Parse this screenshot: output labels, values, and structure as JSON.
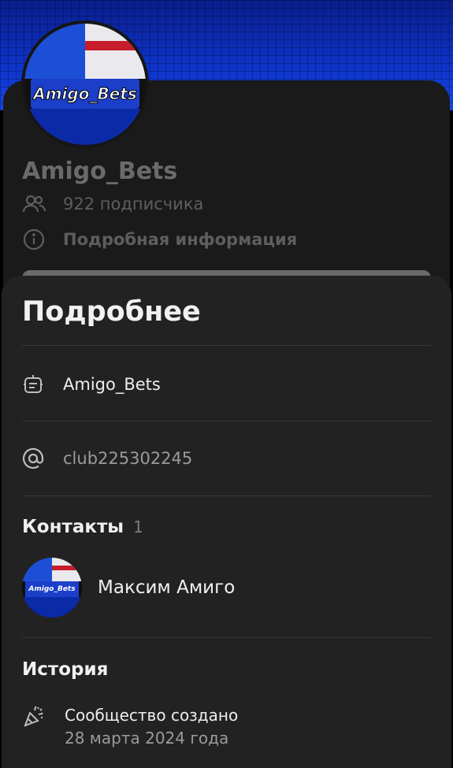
{
  "profile": {
    "name": "Amigo_Bets",
    "avatar_logo_text": "Amigo_Bets",
    "subscribers": "922 подписчика",
    "details_link": "Подробная информация"
  },
  "sheet": {
    "title": "Подробнее",
    "name_row": "Amigo_Bets",
    "short_address": "club225302245",
    "contacts_heading": "Контакты",
    "contacts_count": "1",
    "contacts": [
      {
        "name": "Максим Амиго",
        "avatar_logo_text": "Amigo_Bets"
      }
    ],
    "history_heading": "История",
    "history": [
      {
        "title": "Сообщество создано",
        "date": "28 марта 2024 года"
      }
    ]
  },
  "icons": {
    "subscribers": "people-icon",
    "details": "info-icon",
    "name": "bot-icon",
    "address": "at-sign-icon",
    "history": "party-popper-icon"
  },
  "colors": {
    "cover": "#0d33c9",
    "sheet_bg": "#222222",
    "card_bg": "#1a1a1a",
    "text_primary": "#f0f0f0",
    "text_secondary": "#9b9b9b"
  }
}
